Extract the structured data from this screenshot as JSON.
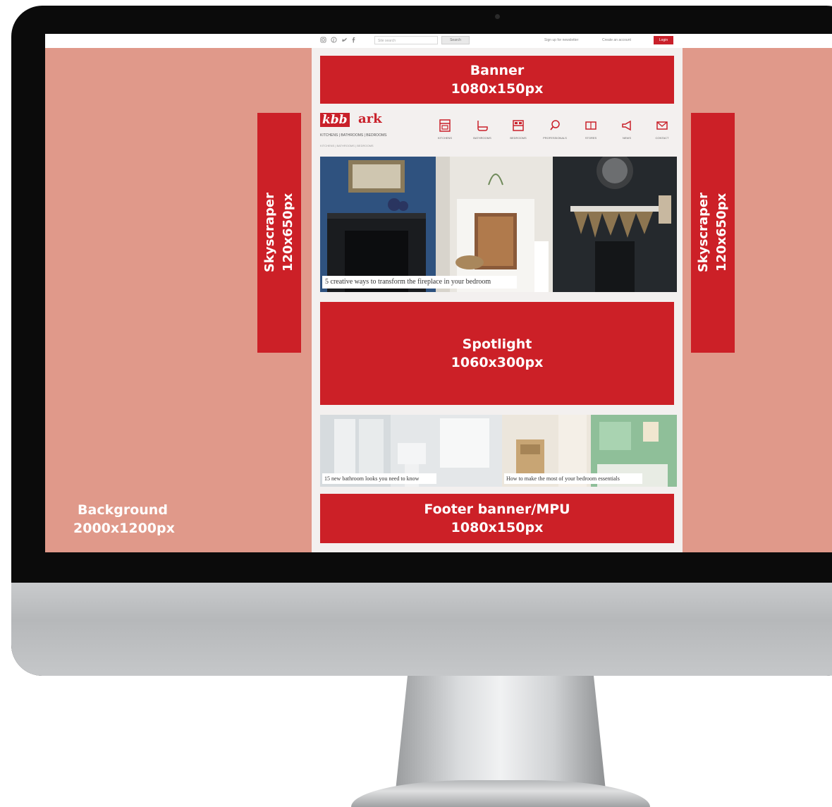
{
  "colors": {
    "screen_background": "#e0998a",
    "ad_red": "#cc2027",
    "page_background": "#f3f0ef",
    "monitor_bezel": "#0b0b0b"
  },
  "topbar": {
    "icons": [
      "instagram-icon",
      "pinterest-icon",
      "twitter-icon",
      "facebook-icon"
    ],
    "search_placeholder": "Site search",
    "search_button": "Search",
    "newsletter_link": "Sign up for newsletter",
    "account_link": "Create an account",
    "login_button": "Login"
  },
  "ad_slots": {
    "banner": {
      "title": "Banner",
      "size": "1080x150px"
    },
    "skyscraper_left": {
      "title": "Skyscraper",
      "size": "120x650px"
    },
    "skyscraper_right": {
      "title": "Skyscraper",
      "size": "120x650px"
    },
    "spotlight": {
      "title": "Spotlight",
      "size": "1060x300px"
    },
    "footer": {
      "title": "Footer banner/MPU",
      "size": "1080x150px"
    },
    "background": {
      "title": "Background",
      "size": "2000x1200px"
    }
  },
  "site": {
    "logo_kbb": "kbb",
    "logo_ark": "ark",
    "tagline": "KITCHENS | BATHROOMS | BEDROOMS",
    "subtagline": "KITCHENS | BATHROOMS | BEDROOMS",
    "nav": [
      {
        "label": "KITCHENS",
        "icon": "oven-icon"
      },
      {
        "label": "BATHROOMS",
        "icon": "bath-icon"
      },
      {
        "label": "BEDROOMS",
        "icon": "bed-icon"
      },
      {
        "label": "PROFESSIONALS",
        "icon": "search-icon"
      },
      {
        "label": "STORES",
        "icon": "store-icon"
      },
      {
        "label": "NEWS",
        "icon": "megaphone-icon"
      },
      {
        "label": "CONTACT",
        "icon": "mail-icon"
      }
    ]
  },
  "articles": {
    "feature_caption": "5 creative ways to transform the fireplace in your bedroom",
    "bottom_left_caption": "15 new bathroom looks you need to know",
    "bottom_right_caption": "How to make the most of your bedroom essentials"
  }
}
